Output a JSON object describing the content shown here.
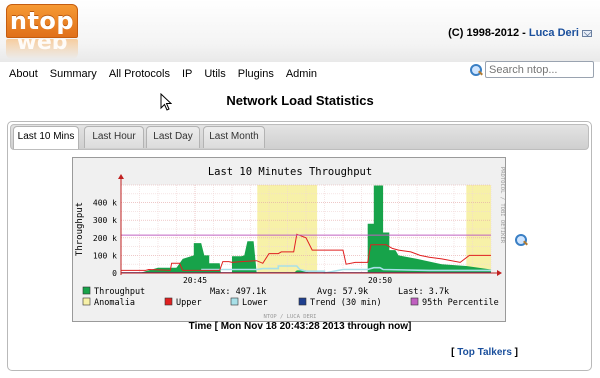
{
  "header": {
    "logo_text": "ntop",
    "logo_reflection": "web",
    "copyright_prefix": "(C) 1998-2012 - ",
    "author": "Luca Deri"
  },
  "nav": {
    "items": [
      "About",
      "Summary",
      "All Protocols",
      "IP",
      "Utils",
      "Plugins",
      "Admin"
    ]
  },
  "search": {
    "placeholder": "Search ntop..."
  },
  "page_title": "Network Load Statistics",
  "tabs": [
    "Last 10 Mins",
    "Last Hour",
    "Last Day",
    "Last Month"
  ],
  "active_tab": "Last 10 Mins",
  "time_range": "Time [ Mon Nov 18 20:43:28 2013 through now]",
  "top_talkers": {
    "prefix": "[ ",
    "label": "Top Talkers",
    "suffix": " ]"
  },
  "colors": {
    "throughput": "#17a34a",
    "anomalia": "#f7f1a8",
    "upper": "#e02020",
    "lower": "#a8e0e8",
    "trend": "#1f3f8f",
    "percentile": "#c060c0",
    "axis": "#c02020"
  },
  "chart_data": {
    "type": "area",
    "title": "Last 10 Minutes Throughput",
    "ylabel": "Throughput",
    "side_label": "PROTOCOL / TOBI OETIKER",
    "footer_label": "NTOP / LUCA DERI",
    "ylim": [
      0,
      500000
    ],
    "yticks": [
      {
        "value": 0,
        "label": "0"
      },
      {
        "value": 100000,
        "label": "100 k"
      },
      {
        "value": 200000,
        "label": "200 k"
      },
      {
        "value": 300000,
        "label": "300 k"
      },
      {
        "value": 400000,
        "label": "400 k"
      }
    ],
    "xticks": [
      {
        "t": 120,
        "label": "20:45"
      },
      {
        "t": 420,
        "label": "20:50"
      }
    ],
    "xlim": [
      0,
      600
    ],
    "percentile_95": 215000,
    "anomalia": [
      [
        221,
        318
      ],
      [
        560,
        600
      ]
    ],
    "series": [
      {
        "name": "Throughput",
        "points": [
          [
            0,
            0
          ],
          [
            30,
            0
          ],
          [
            60,
            30000
          ],
          [
            90,
            30000
          ],
          [
            100,
            80000
          ],
          [
            118,
            100000
          ],
          [
            118,
            170000
          ],
          [
            130,
            170000
          ],
          [
            135,
            100000
          ],
          [
            143,
            100000
          ],
          [
            143,
            55000
          ],
          [
            160,
            55000
          ],
          [
            162,
            0
          ],
          [
            180,
            0
          ],
          [
            180,
            95000
          ],
          [
            195,
            95000
          ],
          [
            200,
            100000
          ],
          [
            205,
            180000
          ],
          [
            215,
            180000
          ],
          [
            220,
            0
          ],
          [
            280,
            0
          ],
          [
            285,
            15000
          ],
          [
            300,
            15000
          ],
          [
            305,
            0
          ],
          [
            400,
            0
          ],
          [
            400,
            280000
          ],
          [
            410,
            280000
          ],
          [
            410,
            497000
          ],
          [
            425,
            497000
          ],
          [
            425,
            230000
          ],
          [
            435,
            230000
          ],
          [
            435,
            130000
          ],
          [
            445,
            130000
          ],
          [
            450,
            100000
          ],
          [
            480,
            80000
          ],
          [
            520,
            50000
          ],
          [
            560,
            40000
          ],
          [
            600,
            20000
          ]
        ]
      },
      {
        "name": "Upper",
        "points": [
          [
            0,
            15000
          ],
          [
            40,
            15000
          ],
          [
            45,
            20000
          ],
          [
            80,
            15000
          ],
          [
            82,
            55000
          ],
          [
            95,
            55000
          ],
          [
            100,
            15000
          ],
          [
            160,
            15000
          ],
          [
            165,
            65000
          ],
          [
            175,
            65000
          ],
          [
            180,
            60000
          ],
          [
            195,
            65000
          ],
          [
            220,
            70000
          ],
          [
            230,
            55000
          ],
          [
            240,
            110000
          ],
          [
            255,
            110000
          ],
          [
            260,
            120000
          ],
          [
            280,
            120000
          ],
          [
            285,
            220000
          ],
          [
            300,
            200000
          ],
          [
            310,
            130000
          ],
          [
            360,
            130000
          ],
          [
            365,
            50000
          ],
          [
            380,
            60000
          ],
          [
            400,
            60000
          ],
          [
            405,
            160000
          ],
          [
            430,
            160000
          ],
          [
            440,
            140000
          ],
          [
            450,
            130000
          ],
          [
            470,
            120000
          ],
          [
            485,
            100000
          ],
          [
            500,
            90000
          ],
          [
            520,
            80000
          ],
          [
            550,
            60000
          ],
          [
            565,
            100000
          ],
          [
            600,
            100000
          ]
        ]
      },
      {
        "name": "Lower",
        "points": [
          [
            130,
            20000
          ],
          [
            143,
            20000
          ],
          [
            205,
            20000
          ],
          [
            220,
            20000
          ],
          [
            230,
            25000
          ],
          [
            255,
            25000
          ],
          [
            255,
            40000
          ],
          [
            285,
            40000
          ],
          [
            290,
            20000
          ],
          [
            300,
            10000
          ],
          [
            330,
            10000
          ],
          [
            330,
            0
          ],
          [
            360,
            20000
          ],
          [
            400,
            20000
          ],
          [
            410,
            30000
          ],
          [
            420,
            30000
          ],
          [
            425,
            20000
          ],
          [
            500,
            15000
          ],
          [
            520,
            15000
          ],
          [
            560,
            15000
          ],
          [
            600,
            15000
          ]
        ]
      },
      {
        "name": "Trend (30 min)",
        "points": [
          [
            0,
            2000
          ],
          [
            600,
            2000
          ]
        ]
      }
    ],
    "legend": [
      {
        "key": "throughput",
        "label": "Throughput"
      },
      {
        "key": "anomalia",
        "label": "Anomalia"
      },
      {
        "key": "upper",
        "label": "Upper"
      },
      {
        "key": "lower",
        "label": "Lower"
      },
      {
        "key": "trend",
        "label": "Trend (30 min)"
      },
      {
        "key": "percentile",
        "label": "95th Percentile"
      }
    ],
    "stats": {
      "max": "Max: 497.1k",
      "avg": "Avg: 57.9k",
      "last": "Last: 3.7k"
    }
  }
}
